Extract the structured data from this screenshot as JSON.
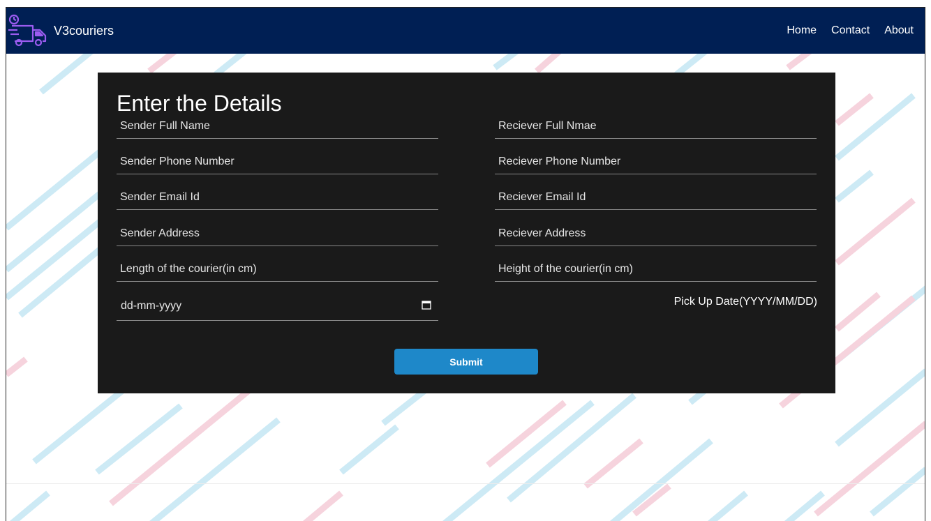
{
  "brand": {
    "name": "V3couriers",
    "logo_icon": "delivery-truck-icon"
  },
  "nav": {
    "items": [
      "Home",
      "Contact",
      "About"
    ]
  },
  "form": {
    "title": "Enter the Details",
    "sender_name_placeholder": "Sender Full Name",
    "sender_phone_placeholder": "Sender Phone Number",
    "sender_email_placeholder": "Sender Email Id",
    "sender_address_placeholder": "Sender Address",
    "length_placeholder": "Length of the courier(in cm)",
    "receiver_name_placeholder": "Reciever Full Nmae",
    "receiver_phone_placeholder": "Reciever Phone Number",
    "receiver_email_placeholder": "Reciever Email Id",
    "receiver_address_placeholder": "Reciever Address",
    "height_placeholder": "Height of the courier(in cm)",
    "date_placeholder": "dd-mm-yyyy",
    "pickup_label": "Pick Up Date(YYYY/MM/DD)",
    "submit_label": "Submit"
  },
  "colors": {
    "navbar": "#001f54",
    "card": "#1a1a1a",
    "submit": "#1e88c9",
    "stripe_blue": "#cdeaf5",
    "stripe_pink": "#f6d3dd",
    "logo": "#9b5cf0"
  }
}
